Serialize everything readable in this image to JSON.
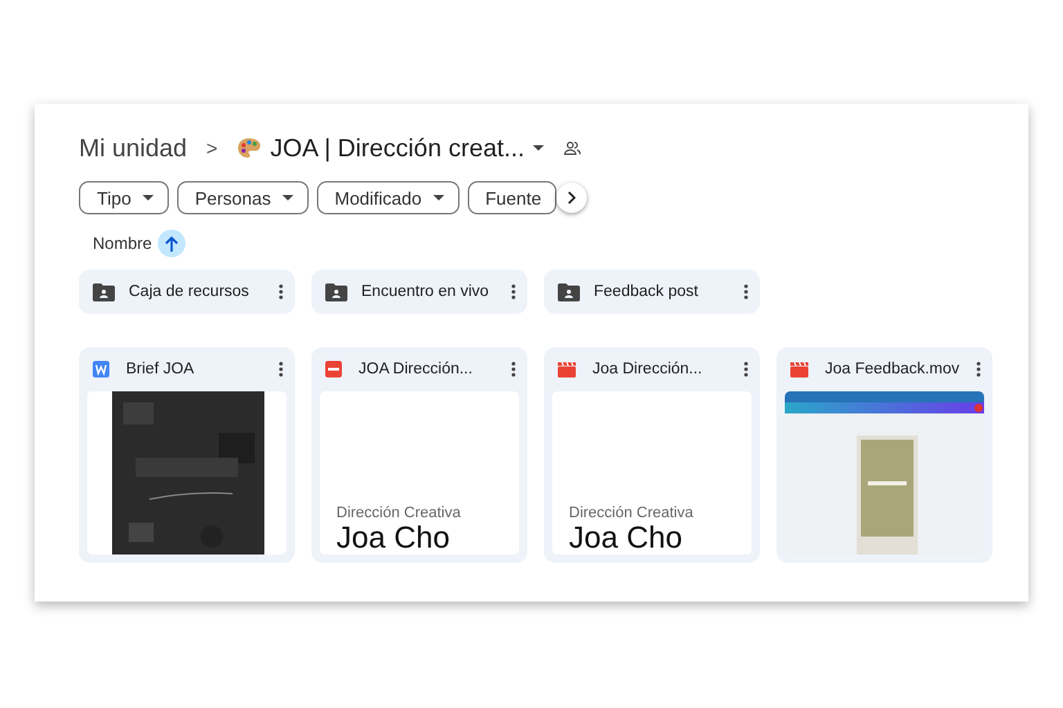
{
  "breadcrumb": {
    "root": "Mi unidad",
    "separator": ">",
    "current": "JOA | Dirección creat..."
  },
  "filters": [
    {
      "label": "Tipo"
    },
    {
      "label": "Personas"
    },
    {
      "label": "Modificado"
    },
    {
      "label": "Fuente"
    }
  ],
  "sort": {
    "label": "Nombre"
  },
  "folders": [
    {
      "name": "Caja de recursos"
    },
    {
      "name": "Encuentro en vivo"
    },
    {
      "name": "Feedback post"
    }
  ],
  "files": [
    {
      "name": "Brief JOA",
      "kind": "word"
    },
    {
      "name": "JOA Dirección...",
      "kind": "pdf",
      "preview": {
        "kind": "document",
        "subtitle": "Dirección Creativa",
        "title": "Joa Cho"
      }
    },
    {
      "name": "Joa Dirección...",
      "kind": "video",
      "preview": {
        "kind": "document",
        "subtitle": "Dirección Creativa",
        "title": "Joa Cho"
      }
    },
    {
      "name": "Joa Feedback.mov",
      "kind": "video",
      "preview": {
        "kind": "screen"
      }
    }
  ]
}
